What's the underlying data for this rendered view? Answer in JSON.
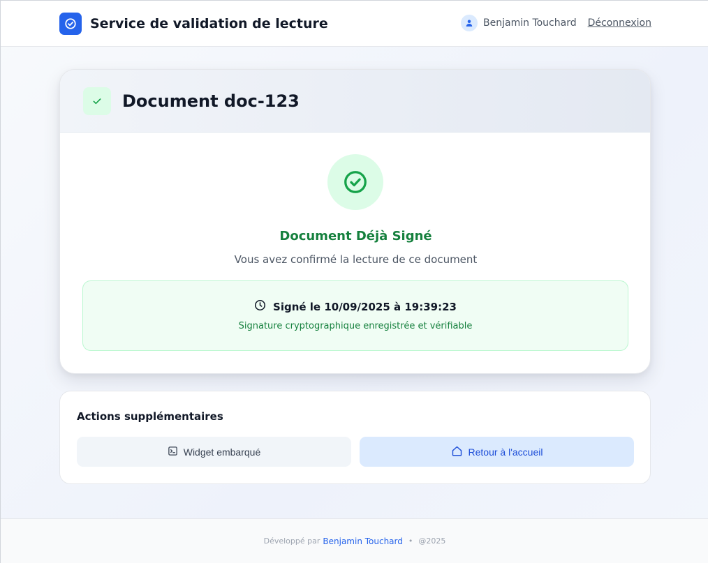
{
  "header": {
    "title": "Service de validation de lecture",
    "user_name": "Benjamin Touchard",
    "logout_label": "Déconnexion",
    "logo_icon": "check-circle-icon",
    "accent_color": "#2563eb"
  },
  "document": {
    "title": "Document doc-123",
    "status_title": "Document Déjà Signé",
    "status_subtitle": "Vous avez confirmé la lecture de ce document",
    "signed_at": "Signé le 10/09/2025 à 19:39:23",
    "signature_note": "Signature cryptographique enregistrée et vérifiable",
    "status_color": "#15803d"
  },
  "actions": {
    "title": "Actions supplémentaires",
    "widget_label": "Widget embarqué",
    "home_label": "Retour à l'accueil"
  },
  "footer": {
    "prefix": "Développé par",
    "author": "Benjamin Touchard",
    "separator": "•",
    "year": "@2025"
  }
}
